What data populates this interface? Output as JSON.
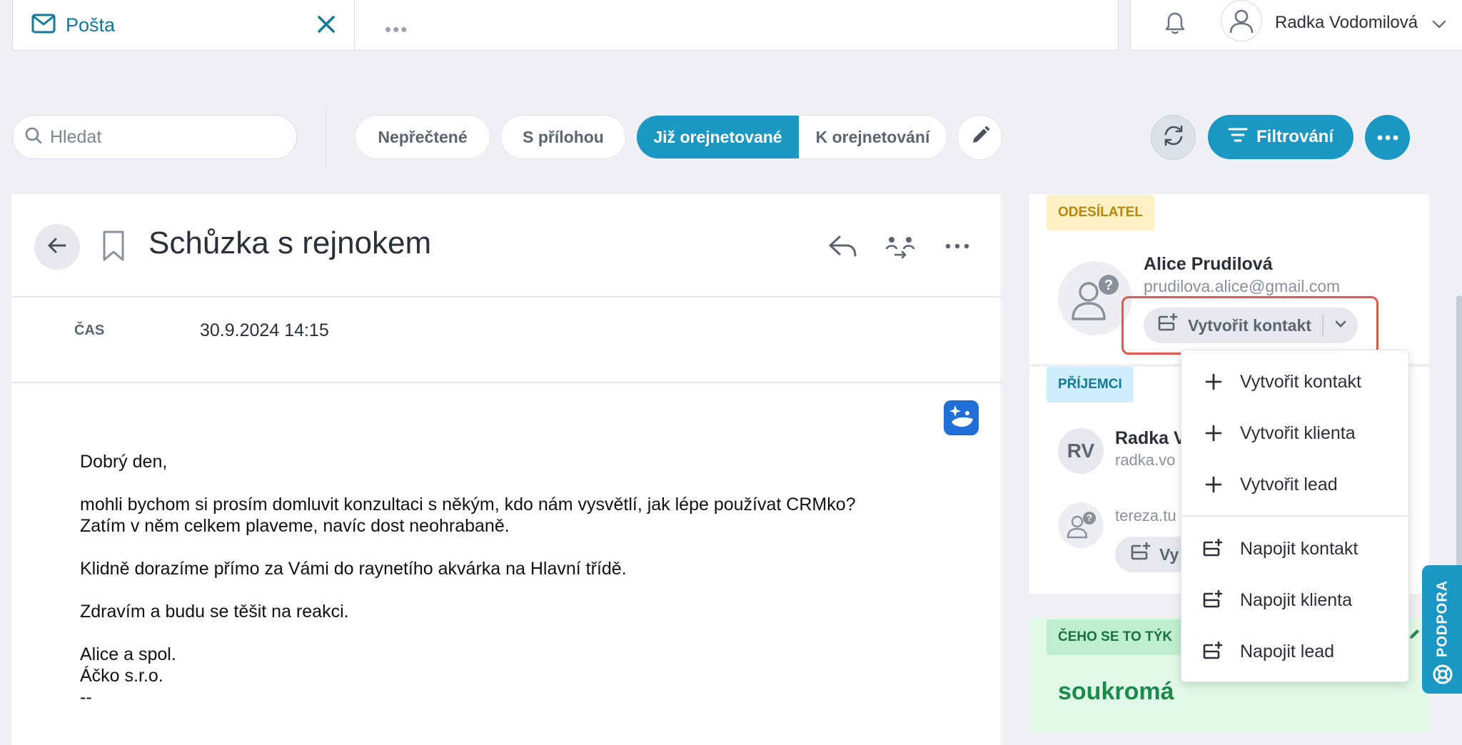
{
  "tabs": {
    "active_label": "Pošta",
    "more_label": "•••"
  },
  "user": {
    "name": "Radka Vodomilová"
  },
  "search": {
    "placeholder": "Hledat"
  },
  "filters": {
    "unread": "Nepřečtené",
    "with_attachment": "S přílohou",
    "already_done": "Již orejnetované",
    "to_do": "K orejnetování",
    "filter_button": "Filtrování"
  },
  "email": {
    "subject": "Schůzka s rejnokem",
    "time_label": "ČAS",
    "time_value": "30.9.2024 14:15",
    "body": [
      "Dobrý den,",
      "mohli bychom si prosím domluvit konzultaci s někým, kdo nám vysvětlí, jak lépe používat CRMko?",
      "Zatím v něm celkem plaveme, navíc dost neohrabaně.",
      "Klidně dorazíme přímo za Vámi do raynetího akvárka na Hlavní třídě.",
      "Zdravím a budu se těšit na reakci.",
      "Alice a spol.",
      "Áčko s.r.o.",
      "--"
    ]
  },
  "sender": {
    "tag": "ODESÍLATEL",
    "name": "Alice Prudilová",
    "email": "prudilova.alice@gmail.com",
    "create_contact": "Vytvořit kontakt"
  },
  "recipients": {
    "tag": "PŘÍJEMCI",
    "items": [
      {
        "initials": "RV",
        "name": "Radka V",
        "email": "radka.vo"
      },
      {
        "email": "tereza.tu",
        "button": "Vy"
      }
    ]
  },
  "topic": {
    "tag": "ČEHO SE TO TÝK",
    "value": "soukromá"
  },
  "menu": {
    "items": [
      {
        "label": "Vytvořit kontakt",
        "icon": "plus-icon"
      },
      {
        "label": "Vytvořit klienta",
        "icon": "plus-icon"
      },
      {
        "label": "Vytvořit lead",
        "icon": "plus-icon"
      },
      {
        "label": "Napojit kontakt",
        "icon": "link-add-icon"
      },
      {
        "label": "Napojit klienta",
        "icon": "link-add-icon"
      },
      {
        "label": "Napojit lead",
        "icon": "link-add-icon"
      }
    ]
  },
  "support": {
    "label": "PODPORA"
  },
  "colors": {
    "accent": "#1a97c2",
    "tab_text": "#127a99",
    "sender_tag_bg": "#fdf0c7",
    "sender_tag_text": "#b8860b",
    "recipients_tag_bg": "#cfeefb",
    "recipients_tag_text": "#127a99",
    "topic_bg": "#dff8e8",
    "topic_text": "#1c8a4a",
    "highlight": "#e3574a"
  }
}
